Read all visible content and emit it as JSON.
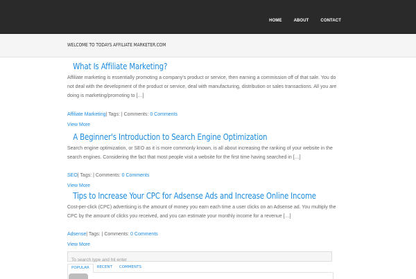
{
  "nav": {
    "items": [
      "HOME",
      "ABOUT",
      "CONTACT"
    ]
  },
  "welcome": "WELCOME TO TODAYS AFFILIATE MARKETER.COM",
  "posts": [
    {
      "title": "What Is Affiliate Marketing?",
      "excerpt": "Affiliate marketing is essentially promoting a company's product or service, then earning a commission off of that sale.  You do not deal with the development of the product or service, deal with manufacturing, distribution or sales transactions.  All you are doing is marketing/promoting to […]",
      "category": "Affiliate Marketing",
      "meta_sep": "| Tags: | Comments:",
      "comments": "0 Comments",
      "view_more": "View More"
    },
    {
      "title": "A Beginner's Introduction to Search Engine Optimization",
      "excerpt": "Search engine optimization, or SEO as it is more commonly known, is all about increasing the ranking of your website in the search engines. Considering the fact that most people visit a website for the first time having searched in […]",
      "category": "SEO",
      "meta_sep": "| Tags: | Comments:",
      "comments": "0 Comments",
      "view_more": "View More"
    },
    {
      "title": "Tips to Increase Your CPC for Adsense Ads and Increase Online Income",
      "excerpt": "Cost-per-click (CPC) advertising is the amount of money you earn each time a user clicks on an Adsense ad. You multiply the CPC by the amount of clicks you received, and you can estimate your monthly income for a revenue […]",
      "category": "Adsense",
      "meta_sep": "| Tags: | Comments:",
      "comments": "0 Comments",
      "view_more": "View More"
    }
  ],
  "search": {
    "placeholder": "To search type and hit enter"
  },
  "tabs": [
    "POPULAR",
    "RECENT",
    "COMMENTS"
  ],
  "colors": {
    "topbar": "#2a2a2a",
    "accent": "#1b8be0",
    "band": "#f5f5f5"
  }
}
